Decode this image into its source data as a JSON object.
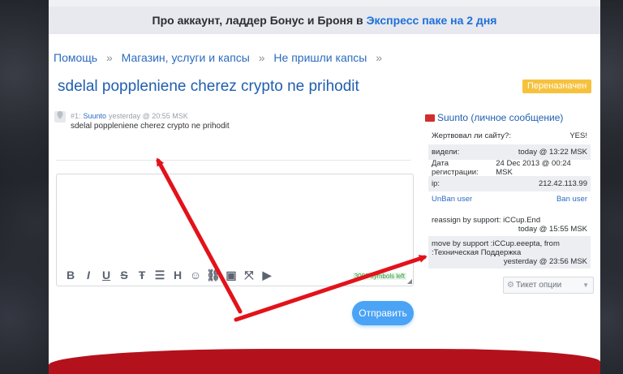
{
  "promo": {
    "text_before": "Про аккаунт, ладдер Бонус и Броня в ",
    "highlight": "Экспресс паке на 2 дня"
  },
  "breadcrumb": [
    "Помощь",
    "Магазин, услуги и капсы",
    "Не пришли капсы"
  ],
  "breadcrumb_separator": "»",
  "ticket": {
    "title": "sdelal poppleniene cherez crypto ne prihodit",
    "status": "Переназначен"
  },
  "post": {
    "number": "#1:",
    "author": "Suunto",
    "time": "yesterday @ 20:55 MSK",
    "body": "sdelal poppleniene cherez crypto ne prihodit"
  },
  "editor": {
    "toolbar_icons": [
      "bold",
      "italic",
      "underline",
      "strikethrough",
      "strike-alt",
      "list",
      "heading",
      "emoji",
      "link",
      "image",
      "collapse",
      "youtube"
    ],
    "counter": "3000 symbols left"
  },
  "send_label": "Отправить",
  "sidebar": {
    "header": "Suunto (личное сообщение)",
    "rows": [
      {
        "label": "Жертвовал ли сайту?:",
        "value": "YES!"
      },
      {
        "label": "видели:",
        "value": "today @ 13:22 MSK"
      },
      {
        "label": "Дата регистрации:",
        "value": "24 Dec 2013 @ 00:24 MSK"
      },
      {
        "label": "ip:",
        "value": "212.42.113.99"
      }
    ],
    "unban_label": "UnBan user",
    "ban_label": "Ban user",
    "log": [
      {
        "text": "reassign by support: iCCup.End",
        "when": "today @ 15:55 MSK"
      },
      {
        "text": "move by support :iCCup.eeepta, from :Техническая Поддержка",
        "when": "yesterday @ 23:56 MSK"
      }
    ],
    "ticket_options_label": "Тикет опции"
  },
  "colors": {
    "accent": "#1f5fae",
    "link": "#2a6bbf",
    "status_badge": "#f6c23e",
    "send_button": "#4aa3f5",
    "annotation_arrow": "#e3121a",
    "footer": "#b3121d"
  }
}
